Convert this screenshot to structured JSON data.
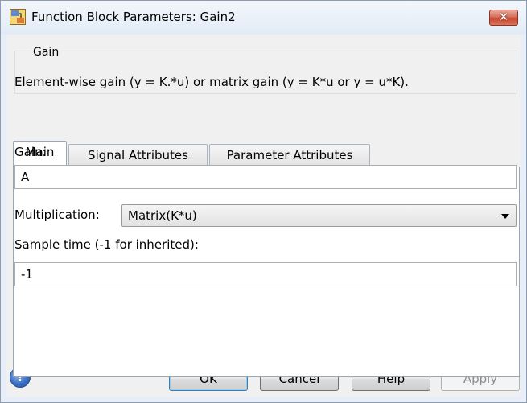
{
  "window": {
    "title": "Function Block Parameters: Gain2",
    "close_label": "✕"
  },
  "gain_group": {
    "legend": "Gain",
    "description": "Element-wise gain (y = K.*u) or matrix gain (y = K*u or y = u*K)."
  },
  "tabs": [
    {
      "label": "Main",
      "active": true
    },
    {
      "label": "Signal Attributes",
      "active": false
    },
    {
      "label": "Parameter Attributes",
      "active": false
    }
  ],
  "main": {
    "gain_label": "Gain:",
    "gain_value": "A",
    "multiplication_label": "Multiplication:",
    "multiplication_value": "Matrix(K*u)",
    "sample_time_label": "Sample time (-1 for inherited):",
    "sample_time_value": "-1"
  },
  "buttons": {
    "help_icon_glyph": "?",
    "ok": "OK",
    "cancel": "Cancel",
    "help": "Help",
    "apply": "Apply"
  },
  "icons": {
    "app_icon": "simulink-block-icon",
    "help_icon": "question-mark-icon",
    "close_icon": "close-icon",
    "dropdown_icon": "chevron-down-icon"
  },
  "colors": {
    "close_button": "#c7472f",
    "help_icon": "#3a72c8",
    "default_button_border": "#3c7fb1"
  }
}
